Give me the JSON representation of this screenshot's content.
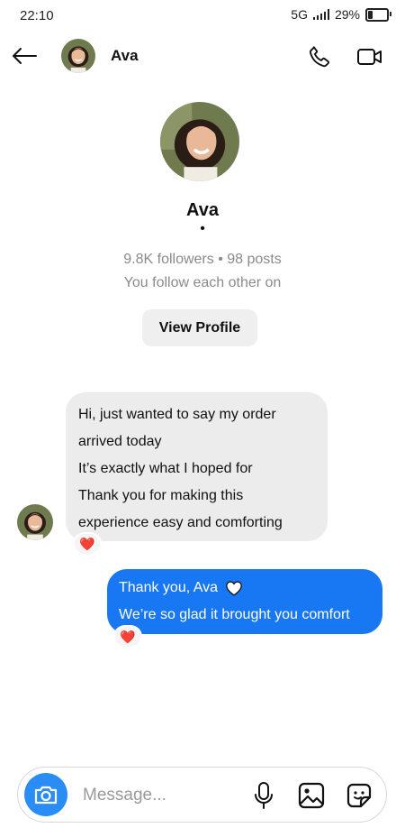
{
  "status_bar": {
    "time": "22:10",
    "network": "5G",
    "battery": "29%",
    "battery_level": 0.29
  },
  "header": {
    "contact_name": "Ava",
    "back_icon": "back-arrow-icon",
    "call_icon": "phone-icon",
    "video_icon": "video-camera-icon"
  },
  "profile": {
    "name": "Ava",
    "separator": "•",
    "stats": "9.8K followers • 98 posts",
    "follow_status": "You follow each other on",
    "view_profile_label": "View Profile"
  },
  "messages": {
    "incoming": {
      "lines": [
        "Hi, just wanted to say my order",
        "arrived today",
        "It’s exactly what I hoped for",
        "Thank you for making this",
        "experience easy and comforting"
      ],
      "reaction": "❤️"
    },
    "outgoing": {
      "line1": "Thank you, Ava",
      "line2": "We’re so glad it brought you comfort",
      "heart_icon": "white-heart-icon",
      "reaction": "❤️"
    }
  },
  "composer": {
    "placeholder": "Message...",
    "accent_color": "#2a8cf5"
  },
  "colors": {
    "outgoing_bubble": "#1877f2",
    "incoming_bubble": "#ececec",
    "muted_text": "#8a8a8a"
  }
}
